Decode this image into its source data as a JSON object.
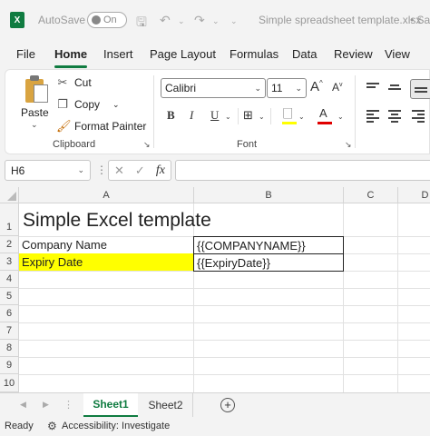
{
  "titlebar": {
    "logo": "X",
    "autosave_label": "AutoSave",
    "autosave_state": "On",
    "title": "Simple spreadsheet template.xlsx",
    "title_sep": "• Sa"
  },
  "menu": {
    "tabs": [
      "File",
      "Home",
      "Insert",
      "Page Layout",
      "Formulas",
      "Data",
      "Review",
      "View"
    ],
    "active": "Home"
  },
  "ribbon": {
    "clipboard": {
      "paste": "Paste",
      "cut": "Cut",
      "copy": "Copy",
      "format_painter": "Format Painter",
      "label": "Clipboard"
    },
    "font": {
      "font_name": "Calibri",
      "font_size": "11",
      "label": "Font",
      "fill_color": "#ffff00",
      "font_color": "#e00000"
    }
  },
  "formula_bar": {
    "name_box": "H6",
    "fx": "fx",
    "formula": ""
  },
  "grid": {
    "columns": [
      "A",
      "B",
      "C",
      "D"
    ],
    "rows": [
      "1",
      "2",
      "3",
      "4",
      "5",
      "6",
      "7",
      "8",
      "9",
      "10"
    ],
    "cells": {
      "A1": "Simple Excel template",
      "A2": "Company Name",
      "B2": "{{COMPANYNAME}}",
      "A3": "Expiry Date",
      "B3": "{{ExpiryDate}}"
    }
  },
  "sheets": {
    "tabs": [
      "Sheet1",
      "Sheet2"
    ],
    "active": "Sheet1",
    "add": "+"
  },
  "status": {
    "ready": "Ready",
    "accessibility": "Accessibility: Investigate"
  }
}
